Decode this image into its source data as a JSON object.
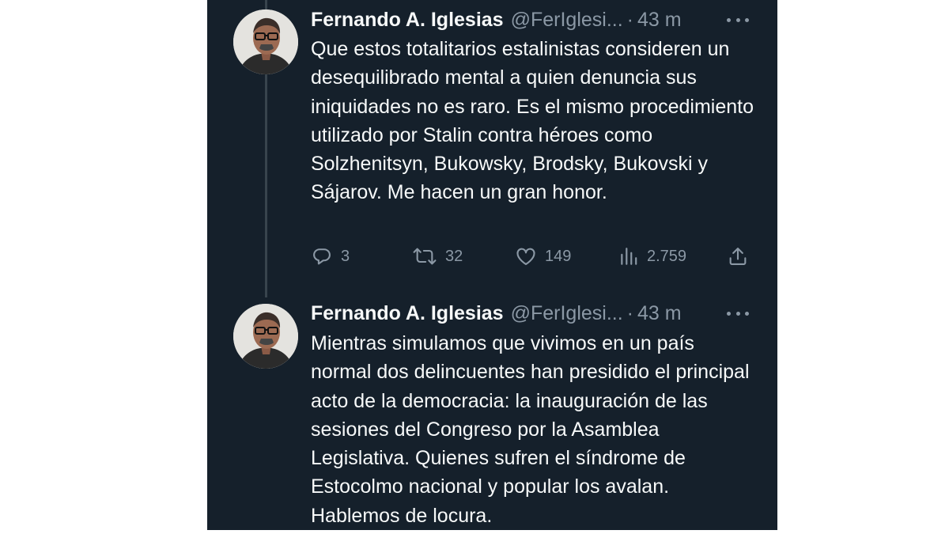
{
  "tweets": [
    {
      "author_name": "Fernando A. Iglesias",
      "handle": "@FerIglesi...",
      "separator": "·",
      "time": "43 m",
      "text": "Que estos totalitarios estalinistas consideren un desequilibrado mental a quien denuncia sus iniquidades no es raro. Es el mismo procedimiento utilizado por Stalin contra héroes como Solzhenitsyn, Bukowsky, Brodsky, Bukovski y Sájarov. Me hacen un gran honor.",
      "reply_icon": "reply-icon",
      "replies": "3",
      "retweet_icon": "retweet-icon",
      "retweets": "32",
      "like_icon": "like-icon",
      "likes": "149",
      "views_icon": "views-icon",
      "views": "2.759",
      "share_icon": "share-icon"
    },
    {
      "author_name": "Fernando A. Iglesias",
      "handle": "@FerIglesi...",
      "separator": "·",
      "time": "43 m",
      "text": "Mientras simulamos que vivimos en un país normal dos delincuentes han presidido el principal acto de la democracia: la inauguración de las sesiones del Congreso por la Asamblea Legislativa. Quienes sufren el síndrome de Estocolmo nacional y popular los avalan. Hablemos de locura."
    }
  ],
  "colors": {
    "background": "#15202b",
    "primary_text": "#f7f9f9",
    "secondary_text": "#8b98a5",
    "thread_line": "#38444d"
  }
}
